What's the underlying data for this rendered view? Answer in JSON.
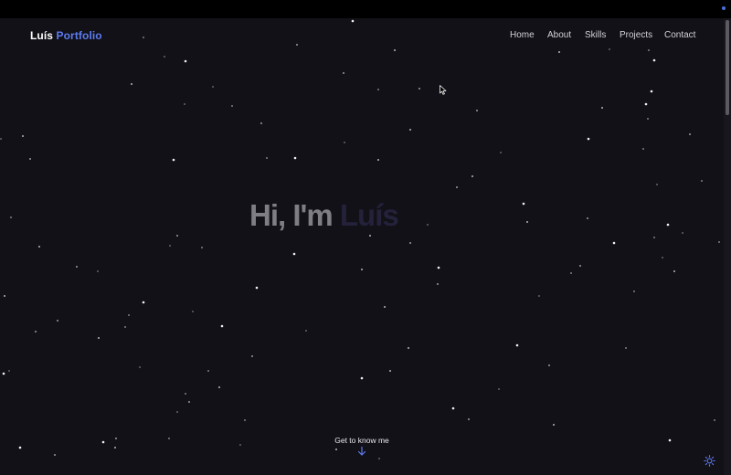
{
  "brand": {
    "name": "Luís",
    "accent": "Portfolio"
  },
  "nav": {
    "home": "Home",
    "about": "About",
    "skills": "Skills",
    "projects": "Projects",
    "contact": "Contact"
  },
  "hero": {
    "greeting": "Hi, I'm",
    "name": "Luís"
  },
  "cta": {
    "label": "Get to know me",
    "icon": "arrow-down-icon"
  },
  "theme_toggle": {
    "icon": "sun-icon"
  },
  "colors": {
    "background": "#121118",
    "accent": "#5d7bf0",
    "text": "#ffffff",
    "nav_text": "#d2d1d8",
    "hero_text": "#7f7e84",
    "star": "#ffffff"
  }
}
